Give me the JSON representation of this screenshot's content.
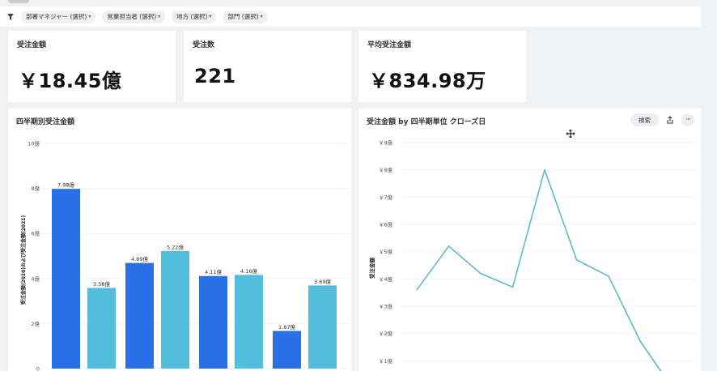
{
  "filters": {
    "items": [
      {
        "label": "部署マネジャー (選択)"
      },
      {
        "label": "営業担当者 (選択)"
      },
      {
        "label": "地方 (選択)"
      },
      {
        "label": "部門 (選択)"
      }
    ]
  },
  "kpis": [
    {
      "title": "受注金額",
      "value": "￥18.45億"
    },
    {
      "title": "受注数",
      "value": "221"
    },
    {
      "title": "平均受注金額",
      "value": "￥834.98万"
    }
  ],
  "bar_panel": {
    "title": "四半期別受注金額"
  },
  "line_panel": {
    "title": "受注金額 by 四半期単位 クローズ日",
    "search_label": "検索",
    "more_label": "···"
  },
  "colors": {
    "dark_blue": "#2b6fe6",
    "light_blue": "#52bedb",
    "line": "#5fb9c9"
  },
  "chart_data": [
    {
      "type": "bar",
      "title": "四半期別受注金額",
      "ylabel": "受注金額(2020)および受注金額(2021)",
      "ylim": [
        0,
        10
      ],
      "yticks": [
        {
          "value": 0,
          "label": "0"
        },
        {
          "value": 2,
          "label": "2億"
        },
        {
          "value": 4,
          "label": "4億"
        },
        {
          "value": 6,
          "label": "6億"
        },
        {
          "value": 8,
          "label": "8億"
        },
        {
          "value": 10,
          "label": "10億"
        }
      ],
      "groups": 4,
      "series": [
        {
          "values": [
            7.98,
            4.69,
            4.11,
            1.67
          ],
          "labels": [
            "7.98億",
            "4.69億",
            "4.11億",
            "1.67億"
          ],
          "color": "#2b6fe6"
        },
        {
          "values": [
            3.58,
            5.22,
            4.16,
            3.69
          ],
          "labels": [
            "3.58億",
            "5.22億",
            "4.16億",
            "3.69億"
          ],
          "color": "#52bedb"
        }
      ]
    },
    {
      "type": "line",
      "title": "受注金額 by 四半期単位 クローズ日",
      "ylabel": "受注金額",
      "ylim": [
        0,
        9
      ],
      "yticks": [
        {
          "value": 1,
          "label": "￥1億"
        },
        {
          "value": 2,
          "label": "￥2億"
        },
        {
          "value": 3,
          "label": "￥3億"
        },
        {
          "value": 4,
          "label": "￥4億"
        },
        {
          "value": 5,
          "label": "￥5億"
        },
        {
          "value": 6,
          "label": "￥6億"
        },
        {
          "value": 7,
          "label": "￥7億"
        },
        {
          "value": 8,
          "label": "￥8億"
        },
        {
          "value": 9,
          "label": "￥9億"
        }
      ],
      "values": [
        3.6,
        5.2,
        4.2,
        3.7,
        8.0,
        4.7,
        4.1,
        1.7,
        0.0
      ]
    }
  ]
}
